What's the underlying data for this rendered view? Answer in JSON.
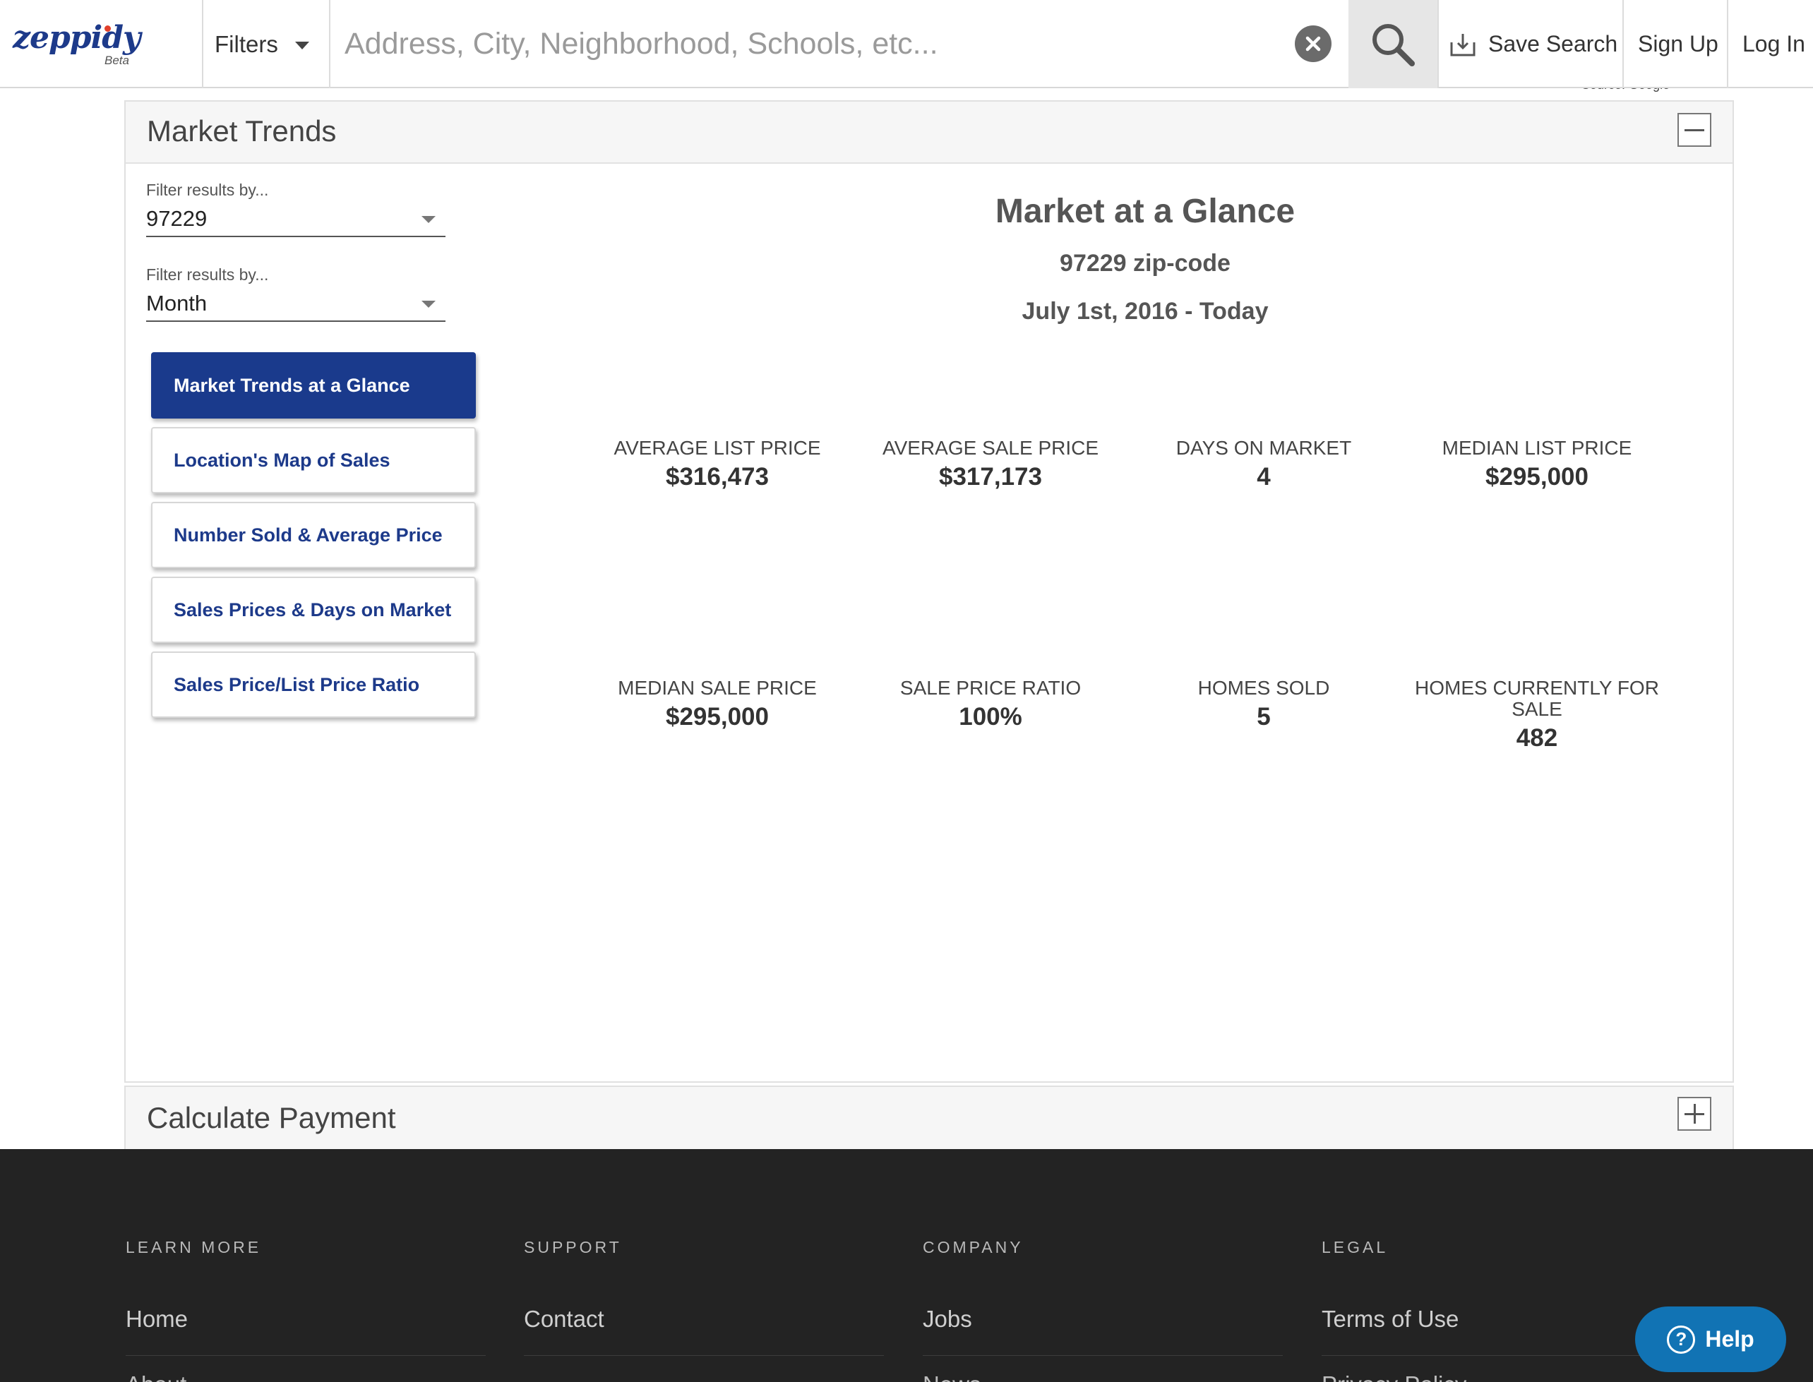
{
  "header": {
    "logo_text": "zeppidy",
    "logo_badge": "Beta",
    "filters_label": "Filters",
    "search_placeholder": "Address, City, Neighborhood, Schools, etc...",
    "save_search_label": "Save Search",
    "signup_label": "Sign Up",
    "login_label": "Log In"
  },
  "market_trends": {
    "title": "Market Trends",
    "source_text": "Source: Google",
    "filters": [
      {
        "label": "Filter results by...",
        "value": "97229"
      },
      {
        "label": "Filter results by...",
        "value": "Month"
      }
    ],
    "nav": [
      {
        "label": "Market Trends at a Glance",
        "active": true
      },
      {
        "label": "Location's Map of Sales",
        "active": false
      },
      {
        "label": "Number Sold & Average Price",
        "active": false
      },
      {
        "label": "Sales Prices & Days on Market",
        "active": false
      },
      {
        "label": "Sales Price/List Price Ratio",
        "active": false
      }
    ],
    "glance": {
      "title": "Market at a Glance",
      "zip": "97229 zip-code",
      "range": "July 1st, 2016 - Today"
    },
    "stats": [
      {
        "label": "AVERAGE LIST PRICE",
        "value": "$316,473"
      },
      {
        "label": "AVERAGE SALE PRICE",
        "value": "$317,173"
      },
      {
        "label": "DAYS ON MARKET",
        "value": "4"
      },
      {
        "label": "MEDIAN LIST PRICE",
        "value": "$295,000"
      },
      {
        "label": "MEDIAN SALE PRICE",
        "value": "$295,000"
      },
      {
        "label": "SALE PRICE RATIO",
        "value": "100%"
      },
      {
        "label": "HOMES SOLD",
        "value": "5"
      },
      {
        "label": "HOMES CURRENTLY FOR SALE",
        "value": "482"
      }
    ]
  },
  "calculate_payment": {
    "title": "Calculate Payment"
  },
  "footer": {
    "columns": [
      {
        "heading": "LEARN MORE",
        "link": "Home",
        "next_link": "About"
      },
      {
        "heading": "SUPPORT",
        "link": "Contact",
        "next_link": ""
      },
      {
        "heading": "COMPANY",
        "link": "Jobs",
        "next_link": "News"
      },
      {
        "heading": "LEGAL",
        "link": "Terms of Use",
        "next_link": "Privacy Policy"
      }
    ]
  },
  "help_label": "Help",
  "colors": {
    "brand_blue": "#1a3a8c",
    "help_blue": "#1173b4",
    "footer_bg": "#232323"
  }
}
